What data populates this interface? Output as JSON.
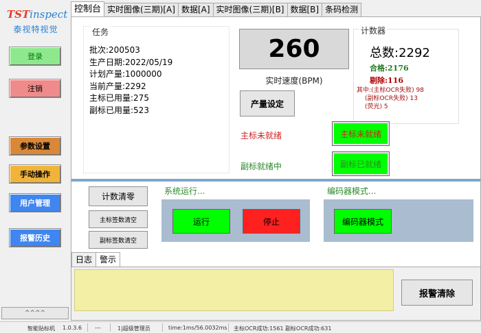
{
  "logo": {
    "brand_prefix": "TST",
    "brand_suffix": "inspect",
    "subtitle": "泰视特视觉"
  },
  "sidebar": {
    "login": "登录",
    "logout": "注销",
    "params": "参数设置",
    "manual": "手动操作",
    "users": "用户管理",
    "alarms": "报警历史",
    "collapse": "^^^^"
  },
  "tabs": [
    "控制台",
    "实时图像(三期)[A]",
    "数据[A]",
    "实时图像(三期)[B]",
    "数据[B]",
    "条码检测"
  ],
  "task": {
    "caption": "任务",
    "lines": [
      "批次:200503",
      "生产日期:2022/05/19",
      "计划产量:1000000",
      "当前产量:2292",
      "主标已用量:275",
      "副标已用量:523"
    ]
  },
  "realtime": {
    "count": "260",
    "speed_label": "实时速度(BPM)",
    "yield_button": "产量设定"
  },
  "counter": {
    "caption": "计数器",
    "total": "总数:2292",
    "pass": "合格:2176",
    "reject": "剔除:116",
    "breakdown": [
      "其中:(主标OCR失败) 98",
      "(副标OCR失败) 13",
      "(荧光) 5"
    ]
  },
  "status": {
    "main_label": "主标未就绪",
    "main_button": "主标未就绪",
    "sub_label": "副标就绪中",
    "sub_button": "副标已就绪"
  },
  "controls": {
    "reset_count": "计数清零",
    "reset_main": "主标签数清空",
    "reset_sub": "副标签数清空",
    "run_caption": "系统运行...",
    "run": "运行",
    "stop": "停止",
    "encoder_caption": "编码器模式...",
    "encoder": "编码器模式"
  },
  "log_tabs": [
    "日志",
    "警示"
  ],
  "alarm_clear": "报警清除",
  "statusbar": {
    "app": "智能贴标机",
    "version": "1.0.3.6",
    "dash": "---",
    "user": "1|超级管理员",
    "time": "time:1ms/56.0032ms",
    "ocr": "主标OCR成功:1561 副标OCR成功:631"
  },
  "colors": {
    "ready_green": "#00ff00",
    "stop_red": "#ff2020",
    "brand_blue": "#2a7fd0",
    "panel_blue": "#a9bcd0",
    "warning_yellow": "#f3f0a6"
  }
}
